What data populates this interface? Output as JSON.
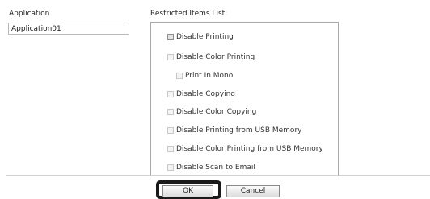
{
  "application": {
    "label": "Application",
    "value": "Application01"
  },
  "restricted": {
    "label": "Restricted Items List:",
    "items": [
      {
        "label": "Disable Printing",
        "checked": false
      },
      {
        "label": "Disable Color Printing",
        "checked": false
      },
      {
        "label": "Print In Mono",
        "checked": false
      },
      {
        "label": "Disable Copying",
        "checked": false
      },
      {
        "label": "Disable Color Copying",
        "checked": false
      },
      {
        "label": "Disable Printing from USB Memory",
        "checked": false
      },
      {
        "label": "Disable Color Printing from USB Memory",
        "checked": false
      },
      {
        "label": "Disable Scan to Email",
        "checked": false
      }
    ]
  },
  "buttons": {
    "ok": "OK",
    "cancel": "Cancel"
  }
}
